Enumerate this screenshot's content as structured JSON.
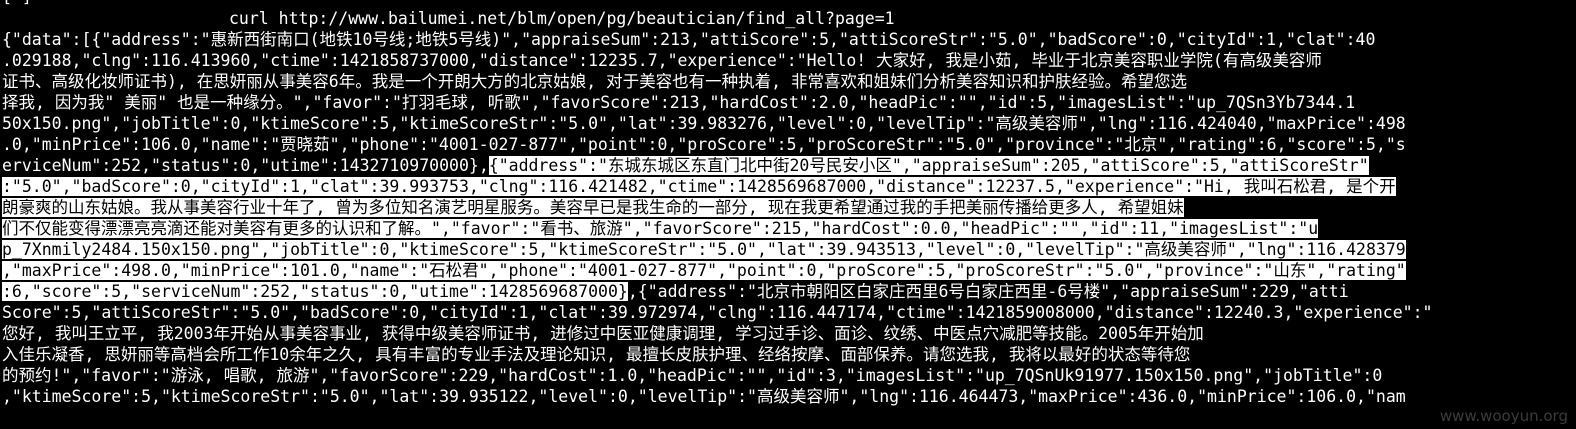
{
  "terminal": {
    "prev_line": "[                           ]",
    "command": "curl http://www.bailumei.net/blm/open/pg/beautician/find_all?page=1",
    "colors": {
      "background": "#000000",
      "text": "#ffffff",
      "highlight_bg": "#ffffff",
      "highlight_text": "#000000"
    },
    "lines": [
      [
        {
          "t": "{\"data\":[{\"address\":\"惠新西街南口(地铁10号线;地铁5号线)\",\"appraiseSum\":213,\"attiScore\":5,\"attiScoreStr\":\"5.0\",\"badScore\":0,\"cityId\":1,\"clat\":40",
          "h": false
        }
      ],
      [
        {
          "t": ".029188,\"clng\":116.413960,\"ctime\":1421858737000,\"distance\":12235.7,\"experience\":\"Hello! 大家好, 我是小茹, 毕业于北京美容职业学院(有高级美容师",
          "h": false
        }
      ],
      [
        {
          "t": "证书、高级化妆师证书), 在思妍丽从事美容6年。我是一个开朗大方的北京姑娘, 对于美容也有一种执着, 非常喜欢和姐妹们分析美容知识和护肤经验。希望您选",
          "h": false
        }
      ],
      [
        {
          "t": "择我, 因为我\" 美丽\" 也是一种缘分。\",\"favor\":\"打羽毛球, 听歌\",\"favorScore\":213,\"hardCost\":2.0,\"headPic\":\"\",\"id\":5,\"imagesList\":\"up_7QSn3Yb7344.1",
          "h": false
        }
      ],
      [
        {
          "t": "50x150.png\",\"jobTitle\":0,\"ktimeScore\":5,\"ktimeScoreStr\":\"5.0\",\"lat\":39.983276,\"level\":0,\"levelTip\":\"高级美容师\",\"lng\":116.424040,\"maxPrice\":498",
          "h": false
        }
      ],
      [
        {
          "t": ".0,\"minPrice\":106.0,\"name\":\"贾晓茹\",\"phone\":\"4001-027-877\",\"point\":0,\"proScore\":5,\"proScoreStr\":\"5.0\",\"province\":\"北京\",\"rating\":6,\"score\":5,\"s",
          "h": false
        }
      ],
      [
        {
          "t": "erviceNum\":252,\"status\":0,\"utime\":1432710970000},",
          "h": false
        },
        {
          "t": "{\"address\":\"东城东城区东直门北中街20号民安小区\",\"appraiseSum\":205,\"attiScore\":5,\"attiScoreStr\"",
          "h": true
        }
      ],
      [
        {
          "t": ":\"5.0\",\"badScore\":0,\"cityId\":1,\"clat\":39.993753,\"clng\":116.421482,\"ctime\":1428569687000,\"distance\":12237.5,\"experience\":\"Hi, 我叫石松君, 是个开",
          "h": true
        }
      ],
      [
        {
          "t": "朗豪爽的山东姑娘。我从事美容行业十年了, 曾为多位知名演艺明星服务。美容早已是我生命的一部分, 现在我更希望通过我的手把美丽传播给更多人, 希望姐妹",
          "h": true
        }
      ],
      [
        {
          "t": "们不仅能变得漂漂亮亮滴还能对美容有更多的认识和了解。\",\"favor\":\"看书、旅游\",\"favorScore\":215,\"hardCost\":0.0,\"headPic\":\"\",\"id\":11,\"imagesList\":\"u",
          "h": true
        }
      ],
      [
        {
          "t": "p_7Xnmily2484.150x150.png\",\"jobTitle\":0,\"ktimeScore\":5,\"ktimeScoreStr\":\"5.0\",\"lat\":39.943513,\"level\":0,\"levelTip\":\"高级美容师\",\"lng\":116.428379",
          "h": true
        }
      ],
      [
        {
          "t": ",\"maxPrice\":498.0,\"minPrice\":101.0,\"name\":\"石松君\",\"phone\":\"4001-027-877\",\"point\":0,\"proScore\":5,\"proScoreStr\":\"5.0\",\"province\":\"山东\",\"rating\"",
          "h": true
        }
      ],
      [
        {
          "t": ":6,\"score\":5,\"serviceNum\":252,\"status\":0,\"utime\":1428569687000}",
          "h": true
        },
        {
          "t": ",{\"address\":\"北京市朝阳区白家庄西里6号白家庄西里-6号楼\",\"appraiseSum\":229,\"atti",
          "h": false
        }
      ],
      [
        {
          "t": "Score\":5,\"attiScoreStr\":\"5.0\",\"badScore\":0,\"cityId\":1,\"clat\":39.972974,\"clng\":116.447174,\"ctime\":1421859008000,\"distance\":12240.3,\"experience\":\"",
          "h": false
        }
      ],
      [
        {
          "t": "您好, 我叫王立平, 我2003年开始从事美容事业, 获得中级美容师证书, 进修过中医亚健康调理, 学习过手诊、面诊、纹绣、中医点穴减肥等技能。2005年开始加",
          "h": false
        }
      ],
      [
        {
          "t": "入佳乐凝香, 思妍丽等高档会所工作10余年之久, 具有丰富的专业手法及理论知识, 最擅长皮肤护理、经络按摩、面部保养。请您选我, 我将以最好的状态等待您",
          "h": false
        }
      ],
      [
        {
          "t": "的预约!\",\"favor\":\"游泳, 唱歌, 旅游\",\"favorScore\":229,\"hardCost\":1.0,\"headPic\":\"\",\"id\":3,\"imagesList\":\"up_7QSnUk91977.150x150.png\",\"jobTitle\":0",
          "h": false
        }
      ],
      [
        {
          "t": ",\"ktimeScore\":5,\"ktimeScoreStr\":\"5.0\",\"lat\":39.935122,\"level\":0,\"levelTip\":\"高级美容师\",\"lng\":116.464473,\"maxPrice\":436.0,\"minPrice\":106.0,\"nam",
          "h": false
        }
      ]
    ]
  },
  "watermark": "www.wooyun.org"
}
